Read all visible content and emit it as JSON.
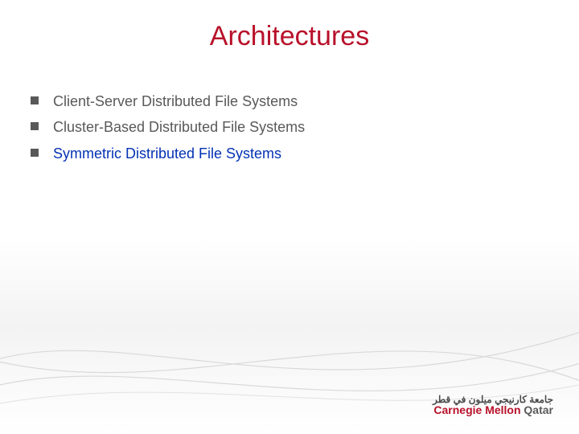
{
  "title": "Architectures",
  "bullets": [
    {
      "text": "Client-Server Distributed File Systems",
      "highlight": false
    },
    {
      "text": "Cluster-Based Distributed File Systems",
      "highlight": false
    },
    {
      "text": "Symmetric Distributed File Systems",
      "highlight": true
    }
  ],
  "logo": {
    "arabic": "جامعة كارنيجي ميلون في قطر",
    "english_cm": "Carnegie Mellon",
    "english_q": " Qatar"
  }
}
